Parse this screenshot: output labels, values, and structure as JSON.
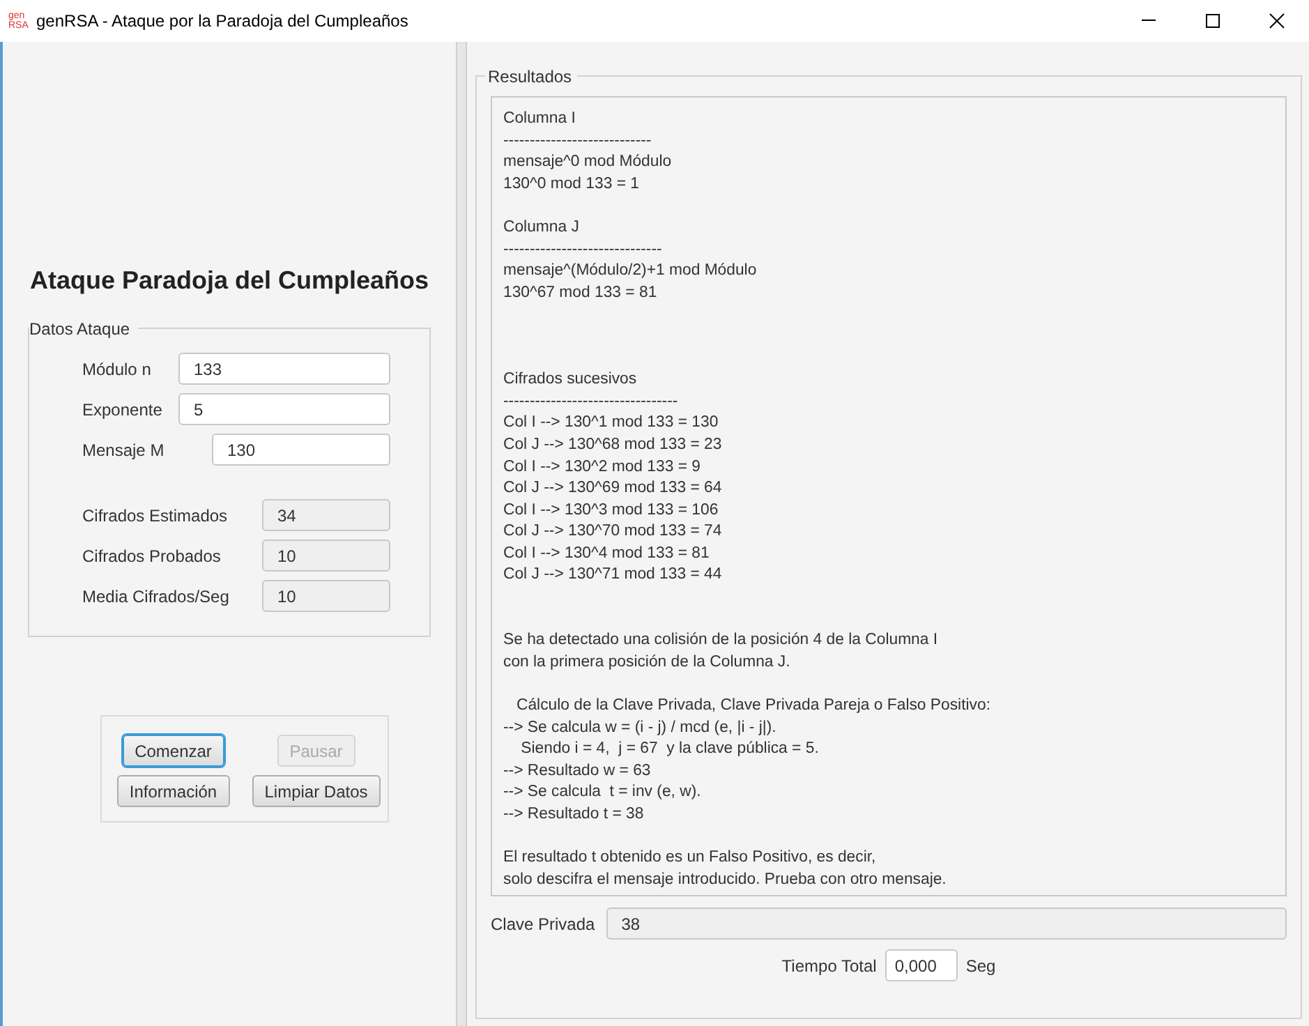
{
  "window": {
    "title": "genRSA - Ataque por la Paradoja del Cumpleaños",
    "icon_text": [
      "gen",
      "RSA"
    ]
  },
  "left_panel": {
    "heading": "Ataque Paradoja del Cumpleaños",
    "group": {
      "title": "Datos Ataque",
      "inputs": [
        {
          "label": "Módulo n",
          "value": "133",
          "kind": "wide"
        },
        {
          "label": "Exponente",
          "value": "5",
          "kind": "wide"
        },
        {
          "label": "Mensaje M",
          "value": "130",
          "kind": "narrow"
        }
      ],
      "outputs": [
        {
          "label": "Cifrados Estimados",
          "value": "34"
        },
        {
          "label": "Cifrados Probados",
          "value": "10"
        },
        {
          "label": "Media Cifrados/Seg",
          "value": "10"
        }
      ]
    },
    "buttons": [
      {
        "label": "Comenzar",
        "disabled": false,
        "focused": true
      },
      {
        "label": "Pausar",
        "disabled": true,
        "focused": false
      },
      {
        "label": "Información",
        "disabled": false,
        "focused": false
      },
      {
        "label": "Limpiar Datos",
        "disabled": false,
        "focused": false
      }
    ]
  },
  "results": {
    "title": "Resultados",
    "log": [
      "Columna I\n----------------------------\nmensaje^0 mod Módulo\n130^0 mod 133 = 1",
      "Columna J\n------------------------------\nmensaje^(Módulo/2)+1 mod Módulo\n130^67 mod 133 = 81",
      "Cifrados sucesivos\n---------------------------------\nCol I --> 130^1 mod 133 = 130\nCol J --> 130^68 mod 133 = 23\nCol I --> 130^2 mod 133 = 9\nCol J --> 130^69 mod 133 = 64\nCol I --> 130^3 mod 133 = 106\nCol J --> 130^70 mod 133 = 74\nCol I --> 130^4 mod 133 = 81\nCol J --> 130^71 mod 133 = 44",
      "Se ha detectado una colisión de la posición 4 de la Columna I\ncon la primera posición de la Columna J.",
      "   Cálculo de la Clave Privada, Clave Privada Pareja o Falso Positivo:\n--> Se calcula w = (i - j) / mcd (e, |i - j|).\n    Siendo i = 4,  j = 67  y la clave pública = 5.\n--> Resultado w = 63\n--> Se calcula  t = inv (e, w).\n--> Resultado t = 38",
      "El resultado t obtenido es un Falso Positivo, es decir,\nsolo descifra el mensaje introducido. Prueba con otro mensaje."
    ],
    "private_key": {
      "label": "Clave Privada",
      "value": "38"
    },
    "total_time": {
      "label": "Tiempo Total",
      "value": "0,000",
      "unit": "Seg"
    }
  }
}
